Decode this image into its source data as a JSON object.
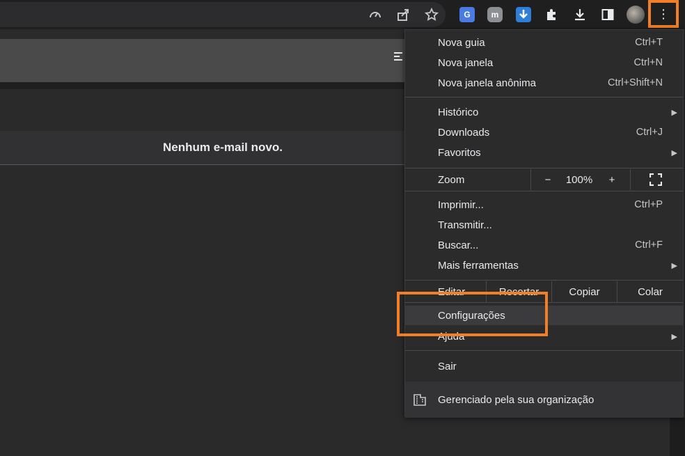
{
  "toolbar": {
    "icons": [
      "performance-icon",
      "share-icon",
      "bookmark-star-icon"
    ],
    "extensions": [
      "google-translate-extension-icon",
      "mastodon-extension-icon",
      "download-arrow-extension-icon",
      "puzzle-extensions-icon",
      "downloads-icon",
      "side-panel-icon"
    ],
    "ext_letters": {
      "translate": "G",
      "mastodon": "m"
    },
    "menu_glyph": "⋮"
  },
  "page": {
    "message": "Nenhum e-mail novo."
  },
  "menu": {
    "items": [
      {
        "label": "Nova guia",
        "shortcut": "Ctrl+T"
      },
      {
        "label": "Nova janela",
        "shortcut": "Ctrl+N"
      },
      {
        "label": "Nova janela anônima",
        "shortcut": "Ctrl+Shift+N"
      },
      {
        "label": "Histórico",
        "shortcut": ""
      },
      {
        "label": "Downloads",
        "shortcut": "Ctrl+J"
      },
      {
        "label": "Favoritos",
        "shortcut": ""
      },
      {
        "label": "Imprimir...",
        "shortcut": "Ctrl+P"
      },
      {
        "label": "Transmitir...",
        "shortcut": ""
      },
      {
        "label": "Buscar...",
        "shortcut": "Ctrl+F"
      },
      {
        "label": "Mais ferramentas",
        "shortcut": ""
      },
      {
        "label": "Configurações",
        "shortcut": ""
      },
      {
        "label": "Ajuda",
        "shortcut": ""
      },
      {
        "label": "Sair",
        "shortcut": ""
      }
    ],
    "zoom": {
      "label": "Zoom",
      "minus": "−",
      "value": "100%",
      "plus": "+"
    },
    "edit": {
      "label": "Editar",
      "cut": "Recortar",
      "copy": "Copiar",
      "paste": "Colar"
    },
    "managed": "Gerenciado pela sua organização",
    "submenu_arrow": "▶"
  },
  "colors": {
    "highlight_box": "#f07f27",
    "menu_bg": "#2b2b2c",
    "page_bg": "#2a2a2b"
  }
}
